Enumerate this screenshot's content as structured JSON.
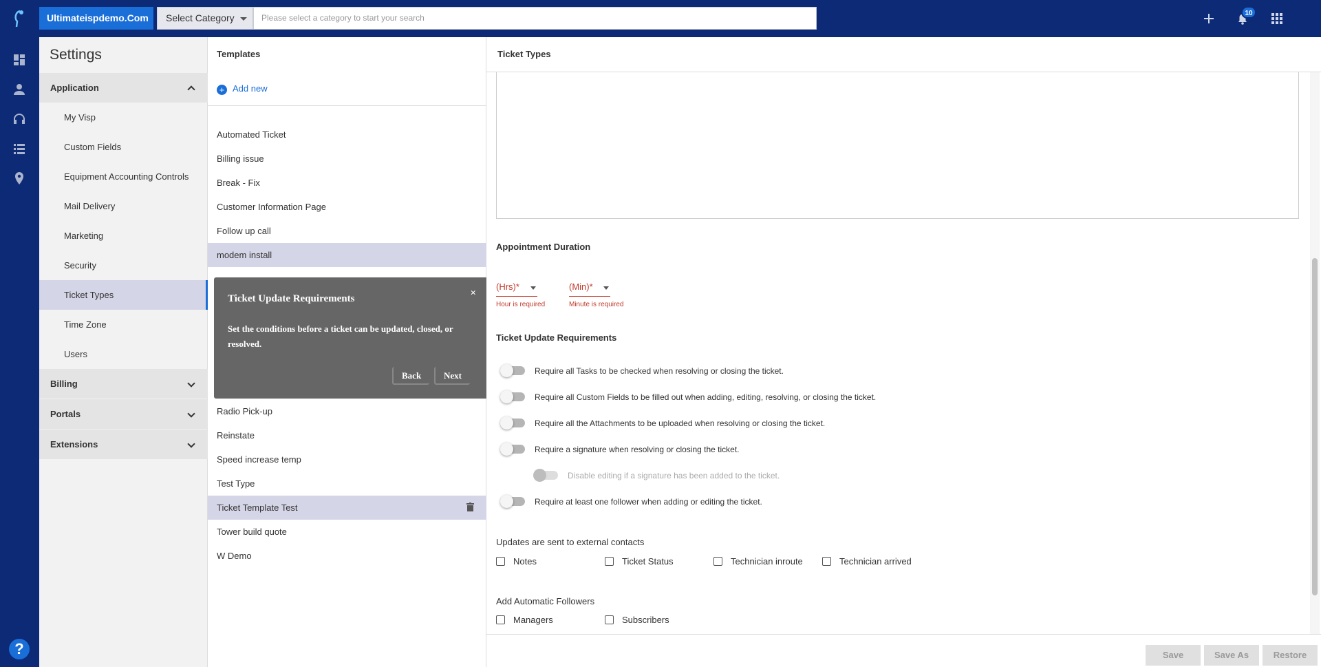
{
  "topbar": {
    "brand": "Ultimateispdemo.Com",
    "category_select": "Select Category",
    "search_placeholder": "Please select a category to start your search",
    "notification_count": "10"
  },
  "settings": {
    "title": "Settings",
    "sections": {
      "application": "Application",
      "billing": "Billing",
      "portals": "Portals",
      "extensions": "Extensions"
    },
    "items": [
      "My Visp",
      "Custom Fields",
      "Equipment Accounting Controls",
      "Mail Delivery",
      "Marketing",
      "Security",
      "Ticket Types",
      "Time Zone",
      "Users"
    ]
  },
  "templates": {
    "title": "Templates",
    "add_new": "Add new",
    "items": [
      "Automated Ticket",
      "Billing issue",
      "Break - Fix",
      "Customer Information Page",
      "Follow up call",
      "modem install",
      "Radio Pick-up",
      "Reinstate",
      "Speed increase temp",
      "Test Type",
      "Ticket Template Test",
      "Tower build quote",
      "W Demo"
    ]
  },
  "popover": {
    "title": "Ticket Update Requirements",
    "body": "Set the conditions before a ticket can be updated, closed, or resolved.",
    "close": "×",
    "back": "Back",
    "next": "Next"
  },
  "main": {
    "title": "Ticket Types",
    "appointment_duration": "Appointment Duration",
    "hrs_label": "(Hrs)*",
    "min_label": "(Min)*",
    "hrs_error": "Hour is required",
    "min_error": "Minute is required",
    "update_req_title": "Ticket Update Requirements",
    "toggles": [
      "Require all Tasks to be checked when resolving or closing the ticket.",
      "Require all Custom Fields to be filled out when adding, editing, resolving, or closing the ticket.",
      "Require all the Attachments to be uploaded when resolving or closing the ticket.",
      "Require a signature when resolving or closing the ticket.",
      "Disable editing if a signature has been added to the ticket.",
      "Require at least one follower when adding or editing the ticket."
    ],
    "external_title": "Updates are sent to external contacts",
    "external": [
      "Notes",
      "Ticket Status",
      "Technician inroute",
      "Technician arrived"
    ],
    "followers_title": "Add Automatic Followers",
    "followers": [
      "Managers",
      "Subscribers"
    ],
    "footer": {
      "save": "Save",
      "save_as": "Save As",
      "restore": "Restore"
    }
  },
  "colors": {
    "navy": "#0d2a77",
    "accent": "#1a6ed8",
    "selected": "#d5d5e8",
    "error": "#c0392b"
  }
}
